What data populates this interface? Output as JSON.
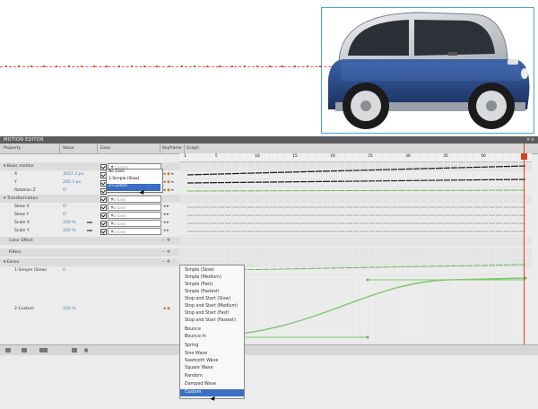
{
  "panel": {
    "title": "MOTION EDITOR",
    "columns": {
      "property": "Property",
      "value": "Value",
      "ease": "Ease",
      "keyframe": "Keyframe",
      "graph": "Graph"
    }
  },
  "timeline": {
    "ticks": [
      "1",
      "5",
      "10",
      "15",
      "20",
      "25",
      "30",
      "35",
      "40"
    ]
  },
  "rows": [
    {
      "type": "section",
      "label": "Basic motion",
      "ease": "2-Custom"
    },
    {
      "type": "prop",
      "label": "X",
      "value": "3557.3 px",
      "ease": "No Ease"
    },
    {
      "type": "prop",
      "label": "Y",
      "value": "292.3 px",
      "ease": "No Ease"
    },
    {
      "type": "prop",
      "label": "Rotation Z",
      "value": "0°",
      "ease": "2-Custom"
    },
    {
      "type": "section",
      "label": "Transformation",
      "ease": "No Ease"
    },
    {
      "type": "prop",
      "label": "Skew X",
      "value": "0°",
      "ease": "No Ease"
    },
    {
      "type": "prop",
      "label": "Skew Y",
      "value": "0°",
      "ease": "No Ease"
    },
    {
      "type": "prop",
      "label": "Scale X",
      "value": "100 %",
      "ease": "No Ease"
    },
    {
      "type": "prop",
      "label": "Scale Y",
      "value": "100 %",
      "ease": "No Ease"
    },
    {
      "type": "section",
      "label": "Color Effect",
      "ease": ""
    },
    {
      "type": "section",
      "label": "Filters",
      "ease": ""
    },
    {
      "type": "section",
      "label": "Eases",
      "ease": ""
    },
    {
      "type": "prop",
      "label": "1-Simple (Slow)",
      "value": "0",
      "ease": ""
    }
  ],
  "custom_row": {
    "label": "2-Custom",
    "value": "100 %"
  },
  "small_popup": {
    "items": [
      "No Ease",
      "1-Simple (Slow)",
      "2-Custom"
    ],
    "selected": "2-Custom"
  },
  "ease_menu": {
    "items": [
      "Simple (Slow)",
      "Simple (Medium)",
      "Simple (Fast)",
      "Simple (Fastest)",
      "Stop and Start (Slow)",
      "Stop and Start (Medium)",
      "Stop and Start (Fast)",
      "Stop and Start (Fastest)",
      "Bounce",
      "Bounce In",
      "Spring",
      "Sine Wave",
      "Sawtooth Wave",
      "Square Wave",
      "Random",
      "Damped Wave",
      "Custom"
    ],
    "selected": "Custom"
  },
  "colors": {
    "accent": "#3a6fc4",
    "playhead": "#d2441c",
    "curve": "#7fc66e",
    "car_body": "#1f3f7a"
  }
}
